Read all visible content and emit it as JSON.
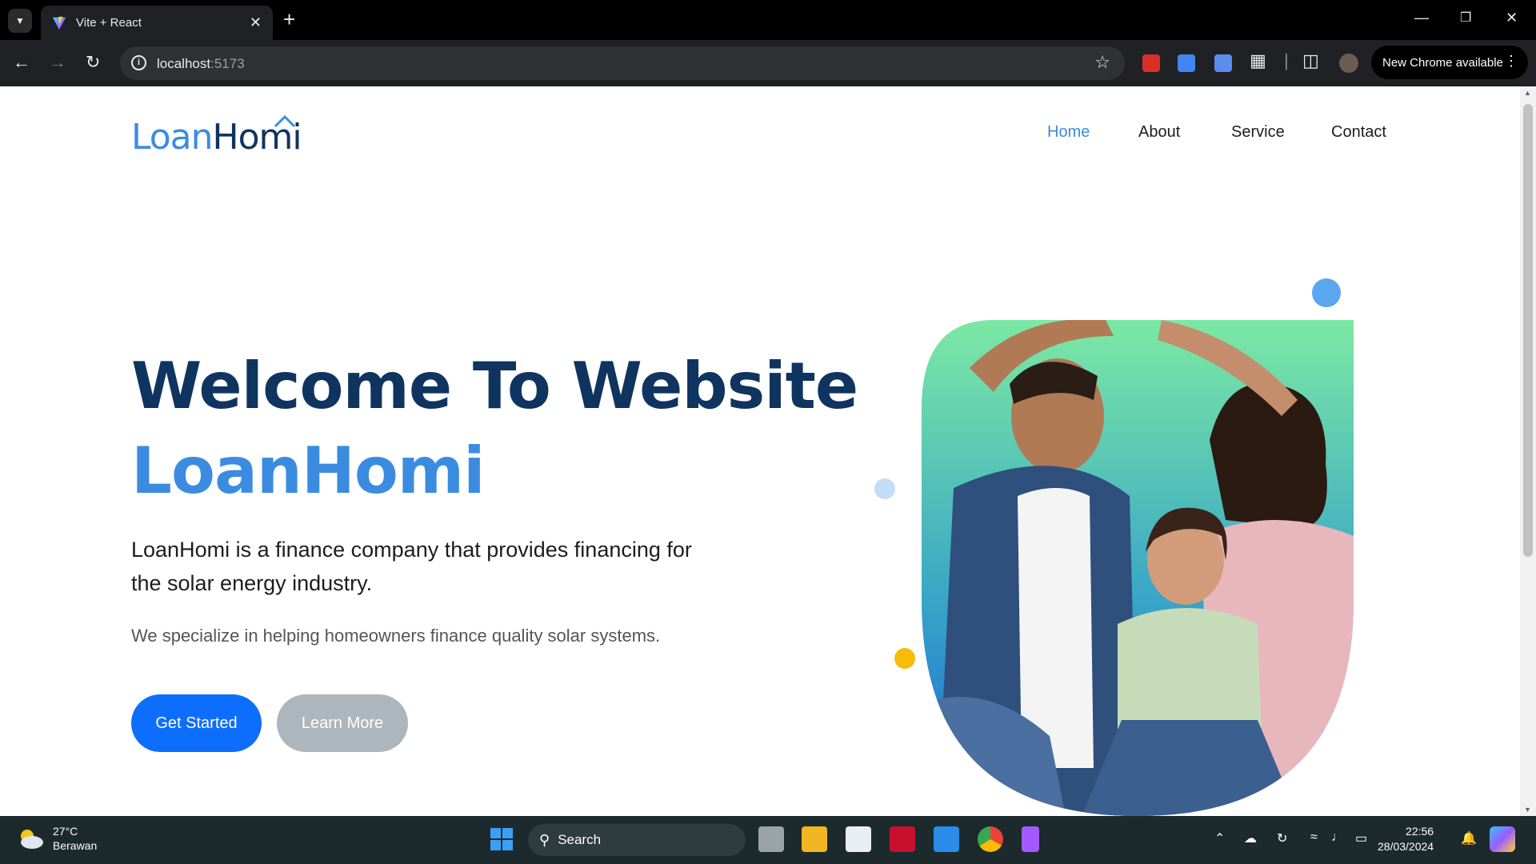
{
  "browser": {
    "tab_title": "Vite + React",
    "url_host": "localhost",
    "url_port": ":5173",
    "update_notice": "New Chrome available"
  },
  "site": {
    "logo_loan": "Loan",
    "logo_homi": "Homi",
    "nav": [
      {
        "label": "Home",
        "active": true
      },
      {
        "label": "About",
        "active": false
      },
      {
        "label": "Service",
        "active": false
      },
      {
        "label": "Contact",
        "active": false
      }
    ],
    "hero": {
      "title": "Welcome To Website",
      "brand": "LoanHomi",
      "description": "LoanHomi is a finance company that provides financing for the solar energy industry.",
      "subtext": "We specialize in helping homeowners finance quality solar systems.",
      "primary_button": "Get Started",
      "secondary_button": "Learn More"
    },
    "colors": {
      "navy": "#0f3460",
      "blue": "#3b8ce0",
      "primary": "#0d6efd",
      "secondary": "#adb5bd"
    }
  },
  "taskbar": {
    "temperature": "27°C",
    "condition": "Berawan",
    "search_label": "Search",
    "time": "22:56",
    "date": "28/03/2024"
  }
}
